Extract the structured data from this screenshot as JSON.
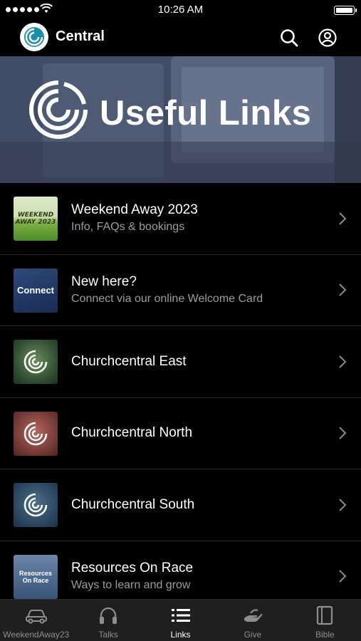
{
  "status_bar": {
    "time": "10:26 AM",
    "signal_bars": 5
  },
  "header": {
    "title": "Central",
    "logo_icon": "churchcentral-logo-icon",
    "search_icon": "search-icon",
    "profile_icon": "profile-icon"
  },
  "banner": {
    "title": "Useful Links",
    "logo_icon": "churchcentral-logo-icon"
  },
  "links": [
    {
      "title": "Weekend Away 2023",
      "subtitle": "Info, FAQs & bookings",
      "thumb_text": [
        "WEEKEND",
        "AWAY 2023"
      ]
    },
    {
      "title": "New here?",
      "subtitle": "Connect via our online Welcome Card",
      "thumb_text": [
        "Connect"
      ]
    },
    {
      "title": "Churchcentral East",
      "subtitle": "",
      "thumb_text": [
        "Churchcentral East"
      ]
    },
    {
      "title": "Churchcentral North",
      "subtitle": "",
      "thumb_text": [
        "Churchcentral North"
      ]
    },
    {
      "title": "Churchcentral South",
      "subtitle": "",
      "thumb_text": [
        "Churchcentral South"
      ]
    },
    {
      "title": "Resources On Race",
      "subtitle": "Ways to learn and grow",
      "thumb_text": [
        "Resources",
        "On Race"
      ]
    }
  ],
  "tabs": [
    {
      "label": "WeekendAway23",
      "icon": "car-icon",
      "active": false
    },
    {
      "label": "Talks",
      "icon": "headphones-icon",
      "active": false
    },
    {
      "label": "Links",
      "icon": "list-icon",
      "active": true
    },
    {
      "label": "Give",
      "icon": "give-hand-icon",
      "active": false
    },
    {
      "label": "Bible",
      "icon": "bible-icon",
      "active": false
    }
  ],
  "colors": {
    "background": "#000000",
    "tab_bar": "#1f1f1f",
    "subtitle": "#9c9c9c",
    "tab_inactive": "#8e8e8e",
    "tab_active": "#ffffff"
  }
}
